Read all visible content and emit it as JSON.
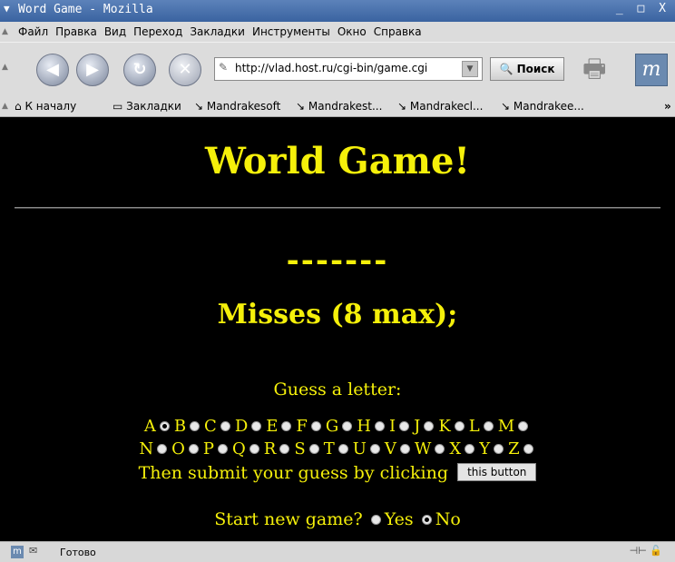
{
  "window": {
    "title": "Word Game - Mozilla",
    "controls": "_ □ X"
  },
  "menu": {
    "items": [
      "Файл",
      "Правка",
      "Вид",
      "Переход",
      "Закладки",
      "Инструменты",
      "Окно",
      "Справка"
    ]
  },
  "nav": {
    "url": "http://vlad.host.ru/cgi-bin/game.cgi",
    "search_label": "Поиск"
  },
  "bookmarks": {
    "home": "К началу",
    "bookmarks": "Закладки",
    "items": [
      "Mandrakesoft",
      "Mandrakest...",
      "Mandrakecl...",
      "Mandrakee..."
    ],
    "more": "»"
  },
  "page": {
    "heading": "World Game!",
    "word": "-------",
    "misses": "Misses (8 max);",
    "guess_prompt": "Guess a letter:",
    "letters_row1": [
      "A",
      "B",
      "C",
      "D",
      "E",
      "F",
      "G",
      "H",
      "I",
      "J",
      "K",
      "L",
      "M"
    ],
    "letters_row2": [
      "N",
      "O",
      "P",
      "Q",
      "R",
      "S",
      "T",
      "U",
      "V",
      "W",
      "X",
      "Y",
      "Z"
    ],
    "selected_letter": "A",
    "submit_text": "Then submit your guess by clicking",
    "submit_button": "this button",
    "new_game_prompt": "Start new game?",
    "yes": "Yes",
    "no": "No",
    "new_game_selected": "No"
  },
  "status": {
    "text": "Готово"
  },
  "colors": {
    "page_background": "#000000",
    "page_text": "#f5f00a",
    "titlebar": "#3a63a0"
  }
}
